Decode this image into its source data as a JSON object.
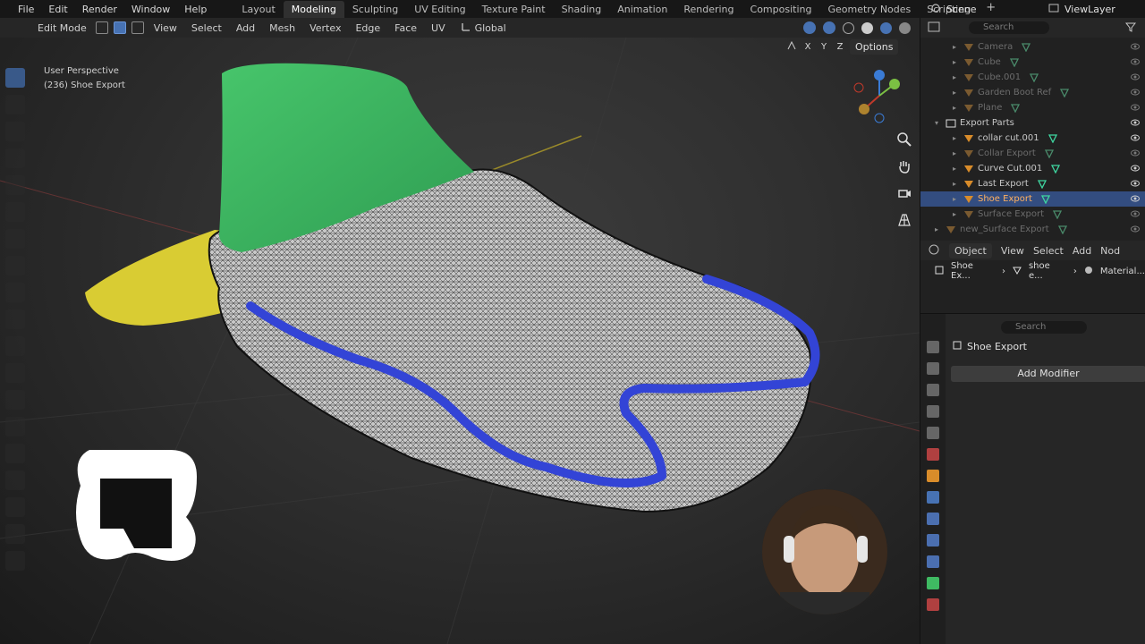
{
  "menu": [
    "File",
    "Edit",
    "Render",
    "Window",
    "Help"
  ],
  "workspaces": [
    "Layout",
    "Modeling",
    "Sculpting",
    "UV Editing",
    "Texture Paint",
    "Shading",
    "Animation",
    "Rendering",
    "Compositing",
    "Geometry Nodes",
    "Scripting"
  ],
  "workspace_plus": "+",
  "scene": "Scene",
  "view_layer": "ViewLayer",
  "viewport": {
    "mode": "Edit Mode",
    "menus": [
      "View",
      "Select",
      "Add",
      "Mesh",
      "Vertex",
      "Edge",
      "Face",
      "UV"
    ],
    "orientation": "Global",
    "axes": [
      "X",
      "Y",
      "Z"
    ],
    "options": "Options",
    "perspective": "User Perspective",
    "object_label": "(236) Shoe Export"
  },
  "outliner": {
    "search_placeholder": "Search",
    "rows": [
      {
        "label": "Camera",
        "dim": true
      },
      {
        "label": "Cube",
        "dim": true
      },
      {
        "label": "Cube.001",
        "dim": true
      },
      {
        "label": "Garden Boot Ref",
        "dim": true
      },
      {
        "label": "Plane",
        "dim": true
      },
      {
        "label": "Export Parts",
        "dim": false
      },
      {
        "label": "collar cut.001",
        "dim": false
      },
      {
        "label": "Collar Export",
        "dim": true
      },
      {
        "label": "Curve Cut.001",
        "dim": false
      },
      {
        "label": "Last Export",
        "dim": false
      },
      {
        "label": "Shoe Export",
        "dim": false,
        "selected": true
      },
      {
        "label": "Surface Export",
        "dim": true
      },
      {
        "label": "new_Surface Export",
        "dim": true
      }
    ]
  },
  "properties_header": {
    "mode": "Object",
    "menus": [
      "View",
      "Select",
      "Add",
      "Nod"
    ]
  },
  "breadcrumb": [
    "Shoe Ex...",
    "shoe e...",
    "Material..."
  ],
  "properties": {
    "search_placeholder": "Search",
    "object_name": "Shoe Export",
    "add_modifier": "Add Modifier"
  },
  "colors": {
    "accent": "#4772b3",
    "selected_row": "#334d80",
    "selected_text": "#ffb060",
    "last_green": "#3fba62",
    "surface_yellow": "#d9cc33",
    "collar_blue": "#3344d6"
  }
}
